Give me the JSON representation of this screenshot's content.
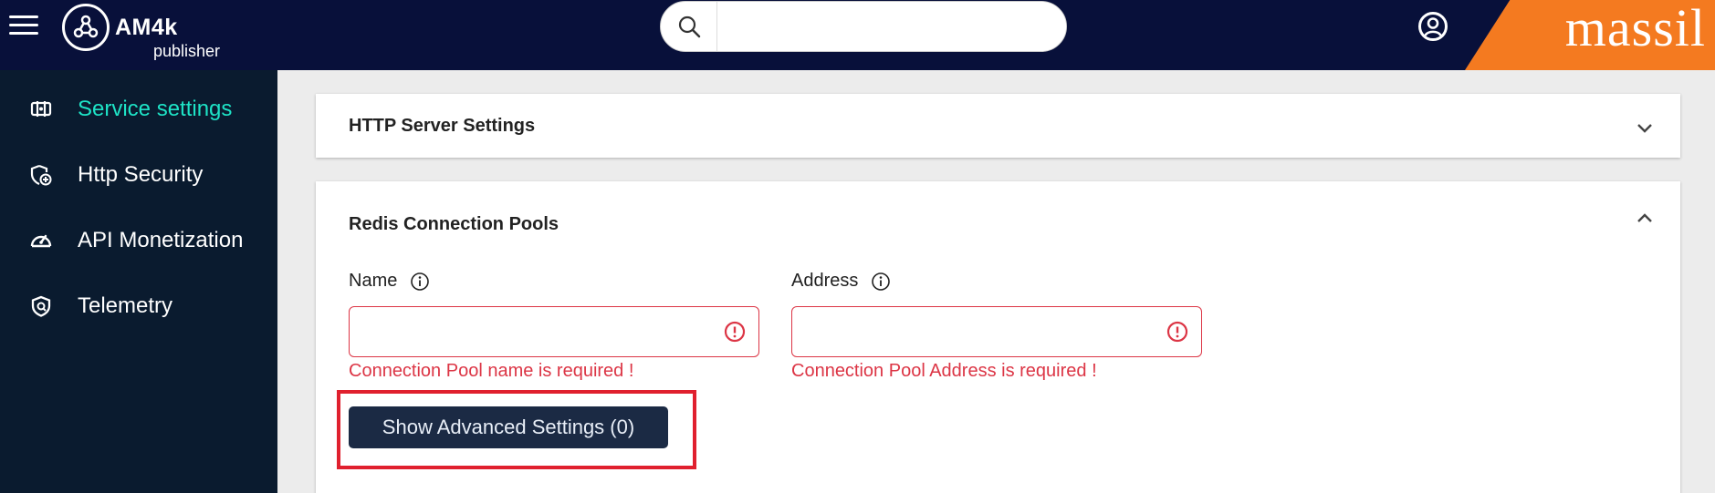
{
  "app": {
    "name": "AM4k",
    "subtitle": "publisher",
    "brand": "massil"
  },
  "search": {
    "value": "",
    "placeholder": ""
  },
  "sidebar": {
    "items": [
      {
        "label": "Service settings",
        "icon": "settings-panel-icon",
        "active": true
      },
      {
        "label": "Http Security",
        "icon": "shield-plus-icon",
        "active": false
      },
      {
        "label": "API Monetization",
        "icon": "speedometer-icon",
        "active": false
      },
      {
        "label": "Telemetry",
        "icon": "shield-check-icon",
        "active": false
      }
    ]
  },
  "main": {
    "http_panel": {
      "title": "HTTP Server Settings",
      "expanded": false
    },
    "redis_panel": {
      "title": "Redis Connection Pools",
      "expanded": true,
      "name_field": {
        "label": "Name",
        "value": "",
        "error": "Connection Pool name is required !"
      },
      "address_field": {
        "label": "Address",
        "value": "",
        "error": "Connection Pool Address is required !"
      },
      "advanced_button": "Show Advanced Settings (0)"
    }
  },
  "colors": {
    "topbar": "#08103a",
    "sidebar": "#0a1b2f",
    "active_nav": "#1ee3c6",
    "brand": "#f47a20",
    "error": "#dc3545",
    "button": "#1b2a44"
  }
}
